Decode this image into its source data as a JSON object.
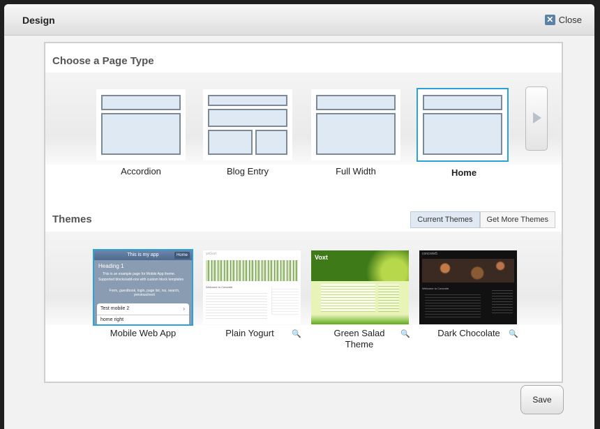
{
  "window": {
    "title": "Design",
    "close_label": "Close"
  },
  "page_type": {
    "heading": "Choose a Page Type",
    "items": [
      {
        "label": "Accordion"
      },
      {
        "label": "Blog Entry"
      },
      {
        "label": "Full Width"
      },
      {
        "label": "Home"
      }
    ],
    "selected": "Home"
  },
  "themes": {
    "heading": "Themes",
    "tabs": [
      {
        "label": "Current Themes"
      },
      {
        "label": "Get More Themes"
      }
    ],
    "items": [
      {
        "label": "Mobile Web App",
        "preview": {
          "header": "This is my app",
          "header_button": "Home",
          "heading": "Heading 1",
          "line1": "This is an example page for Mobile App theme.",
          "line2": "Supported blocks/add-ons with custom block templates",
          "line3": "Form, guestbook, login, page list, rss, search, previous/next",
          "row1": "Test mobile 2",
          "row2": "home right"
        }
      },
      {
        "label": "Plain Yogurt",
        "preview": {
          "brand": "yoGurt",
          "welcome": "Welcome to Concrete"
        }
      },
      {
        "label": "Green Salad Theme",
        "preview": {
          "brand": "Voxt"
        }
      },
      {
        "label": "Dark Chocolate",
        "preview": {
          "brand": "concrete5",
          "welcome": "Welcome to Concrete"
        }
      }
    ]
  },
  "footer": {
    "save_label": "Save"
  },
  "colors": {
    "accent": "#2ba3da",
    "close_icon": "#5a82a6"
  }
}
